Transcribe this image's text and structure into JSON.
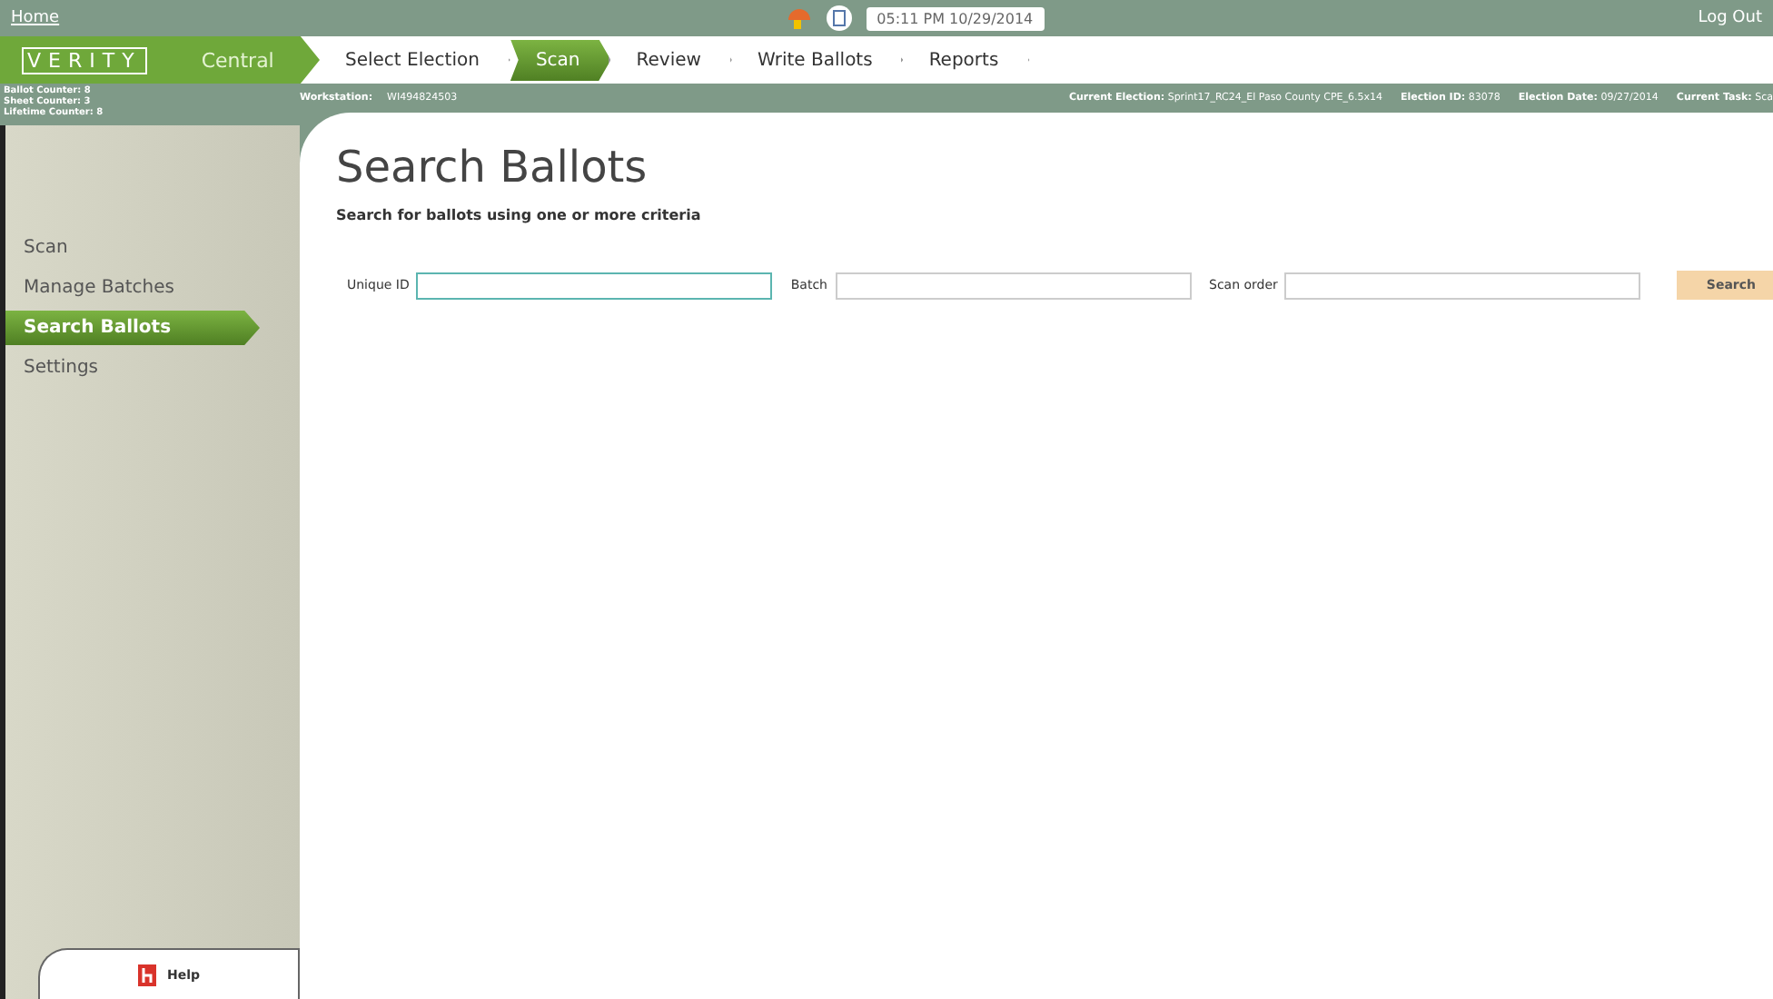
{
  "top_bar": {
    "home_link": "Home",
    "clock": "05:11 PM 10/29/2014",
    "logout_link": "Log Out"
  },
  "brand": {
    "logo": "VERITY",
    "product": "Central"
  },
  "steps": [
    {
      "label": "Select Election",
      "selected": false
    },
    {
      "label": "Scan",
      "selected": true
    },
    {
      "label": "Review",
      "selected": false
    },
    {
      "label": "Write Ballots",
      "selected": false
    },
    {
      "label": "Reports",
      "selected": false
    }
  ],
  "counters": [
    "Ballot Counter: 8",
    "Sheet Counter: 3",
    "Lifetime Counter: 8"
  ],
  "info_bar": {
    "workstation_label": "Workstation:",
    "workstation": "WI494824503",
    "fields": [
      {
        "label": "Current Election:",
        "value": "Sprint17_RC24_El Paso County CPE_6.5x14"
      },
      {
        "label": "Election ID:",
        "value": "83078"
      },
      {
        "label": "Election Date:",
        "value": "09/27/2014"
      },
      {
        "label": "Current Task:",
        "value": "Sca"
      }
    ]
  },
  "sidebar": {
    "items": [
      {
        "label": "Scan",
        "selected": false
      },
      {
        "label": "Manage Batches",
        "selected": false
      },
      {
        "label": "Search Ballots",
        "selected": true
      },
      {
        "label": "Settings",
        "selected": false
      }
    ],
    "help": "Help"
  },
  "page": {
    "title": "Search Ballots",
    "subtitle": "Search for ballots using one or more criteria",
    "fields": [
      {
        "label": "Unique ID",
        "focused": true
      },
      {
        "label": "Batch",
        "focused": false
      },
      {
        "label": "Scan order",
        "focused": false
      }
    ],
    "search_button": "Search"
  }
}
